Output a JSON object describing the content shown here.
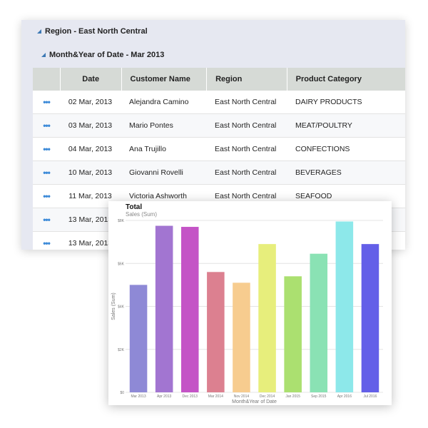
{
  "grid": {
    "group_level1": "Region - East North Central",
    "group_level2": "Month&Year of Date - Mar 2013",
    "columns": [
      "",
      "Date",
      "Customer Name",
      "Region",
      "Product Category"
    ],
    "rows": [
      {
        "date": "02 Mar, 2013",
        "customer": "Alejandra Camino",
        "region": "East North Central",
        "category": "DAIRY PRODUCTS"
      },
      {
        "date": "03 Mar, 2013",
        "customer": "Mario Pontes",
        "region": "East North Central",
        "category": "MEAT/POULTRY"
      },
      {
        "date": "04 Mar, 2013",
        "customer": "Ana Trujillo",
        "region": "East North Central",
        "category": "CONFECTIONS"
      },
      {
        "date": "10 Mar, 2013",
        "customer": "Giovanni Rovelli",
        "region": "East North Central",
        "category": "BEVERAGES"
      },
      {
        "date": "11 Mar, 2013",
        "customer": "Victoria Ashworth",
        "region": "East North Central",
        "category": "SEAFOOD"
      },
      {
        "date": "13 Mar, 2013",
        "customer": "",
        "region": "",
        "category": ""
      },
      {
        "date": "13 Mar, 2013",
        "customer": "",
        "region": "",
        "category": ""
      }
    ],
    "row_menu_glyph": "•••"
  },
  "chart_data": {
    "type": "bar",
    "title": "Total",
    "subtitle": "Sales (Sum)",
    "xlabel": "Month&Year of Date",
    "ylabel": "Sales (Sum)",
    "ylim": [
      0,
      8000
    ],
    "yticks": [
      0,
      2000,
      4000,
      6000,
      8000
    ],
    "ytick_labels": [
      "$0",
      "$2K",
      "$4K",
      "$6K",
      "$8K"
    ],
    "categories": [
      "Mar 2013",
      "Apr 2013",
      "Dec 2013",
      "Mar 2014",
      "Nov 2014",
      "Dec 2014",
      "Jan 2015",
      "Sep 2015",
      "Apr 2016",
      "Jul 2016"
    ],
    "values": [
      5000,
      7750,
      7700,
      5600,
      5100,
      6900,
      5400,
      6450,
      7950,
      6900
    ],
    "colors": [
      "#8e89d6",
      "#a275d1",
      "#c454c6",
      "#dc8090",
      "#f7cc8f",
      "#e7ee7c",
      "#abe070",
      "#8ae2b4",
      "#8de8ea",
      "#635fe8"
    ],
    "grid": true
  }
}
